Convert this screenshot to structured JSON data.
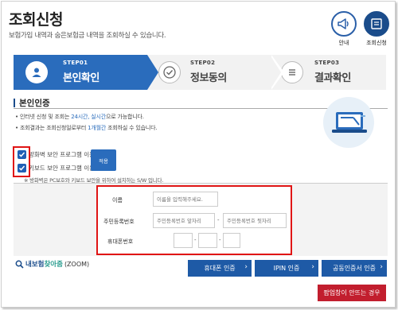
{
  "header": {
    "title": "조회신청",
    "subtitle": "보험가입 내역과 숨은보험금 내역을 조회하실 수 있습니다.",
    "icons": [
      {
        "name": "megaphone-icon",
        "label": "안내"
      },
      {
        "name": "document-search-icon",
        "label": "조회신청"
      }
    ]
  },
  "steps": [
    {
      "no": "STEP01",
      "name": "본인확인",
      "icon": "user-icon",
      "active": true
    },
    {
      "no": "STEP02",
      "name": "정보동의",
      "icon": "check-icon",
      "active": false
    },
    {
      "no": "STEP03",
      "name": "결과확인",
      "icon": "list-icon",
      "active": false
    }
  ],
  "section": {
    "title": "본인인증",
    "bullets": [
      {
        "pre": "인터넷 신청 및 조회는 ",
        "highlight": "24시간, 실시간",
        "post": "으로 가능합니다."
      },
      {
        "pre": "조회결과는 조회신청일로부터 ",
        "highlight": "1개월간",
        "post": " 조회하실 수 있습니다."
      }
    ]
  },
  "security": {
    "options": [
      {
        "label": "방화벽 보안 프로그램 이용",
        "checked": true
      },
      {
        "label": "키보드 보안 프로그램 이용",
        "checked": true
      }
    ],
    "apply_label": "적용",
    "note": "※ 방화벽은 PC보호와 키보드 보안을 위하여 설치하는 S/W 입니다."
  },
  "form": {
    "name_label": "이름",
    "name_placeholder": "이름을 입력해주세요.",
    "rrn_label": "주민등록번호",
    "rrn_front_placeholder": "주민등록번호 앞자리",
    "rrn_back_placeholder": "주민등록번호 뒷자리",
    "phone_label": "휴대폰번호",
    "phone_parts": [
      "",
      "",
      ""
    ]
  },
  "bottom": {
    "find_prefix": "내보험",
    "find_highlight": "찾아줌",
    "find_suffix": "(ZOOM)",
    "buttons": [
      "휴대폰 인증",
      "IPIN 인증",
      "공동인증서 인증"
    ],
    "popup_button": "팝업창이 안뜨는 경우"
  },
  "colors": {
    "primary_blue": "#2a6cbc",
    "dark_blue": "#1a4c8b",
    "highlight_red": "#e01515",
    "popup_red": "#c21e2e"
  }
}
